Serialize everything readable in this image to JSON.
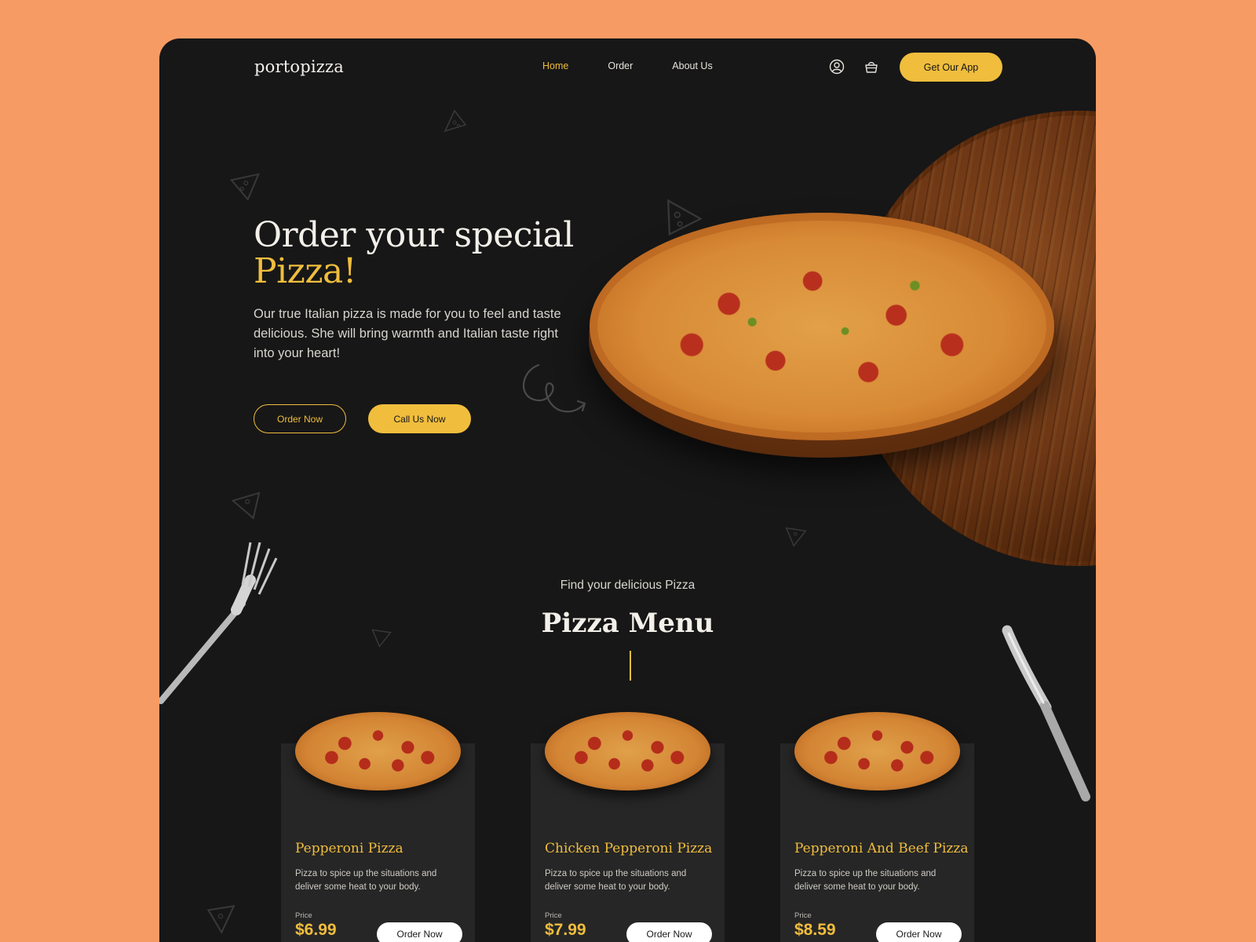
{
  "header": {
    "logo": "portopizza",
    "nav": [
      {
        "label": "Home",
        "active": true
      },
      {
        "label": "Order",
        "active": false
      },
      {
        "label": "About Us",
        "active": false
      }
    ],
    "icons": [
      "user-icon",
      "basket-icon"
    ],
    "cta_label": "Get Our App"
  },
  "hero": {
    "title_line1": "Order your special",
    "title_line2": "Pizza!",
    "description": "Our true Italian pizza is made for you to feel and taste delicious. She will bring warmth and Italian taste right into your heart!",
    "order_label": "Order Now",
    "call_label": "Call Us Now"
  },
  "menu": {
    "kicker": "Find your delicious Pizza",
    "title": "Pizza Menu",
    "price_label": "Price",
    "items": [
      {
        "name": "Pepperoni Pizza",
        "description": "Pizza to spice up the situations and deliver some heat to your body.",
        "price": "$6.99",
        "button": "Order Now"
      },
      {
        "name": "Chicken Pepperoni Pizza",
        "description": "Pizza to spice up the situations and deliver some heat to your body.",
        "price": "$7.99",
        "button": "Order Now"
      },
      {
        "name": "Pepperoni And Beef Pizza",
        "description": "Pizza to spice up the situations and deliver some heat to your body.",
        "price": "$8.59",
        "button": "Order Now"
      }
    ]
  },
  "colors": {
    "background": "#f79b64",
    "page": "#171717",
    "accent": "#f0bd3d",
    "card": "#262626"
  }
}
